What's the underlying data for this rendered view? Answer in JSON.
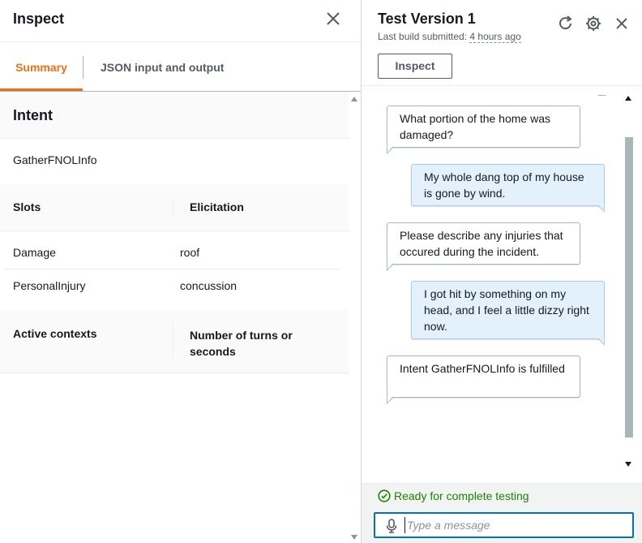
{
  "inspect_panel": {
    "title": "Inspect",
    "tabs": [
      {
        "label": "Summary",
        "active": true
      },
      {
        "label": "JSON input and output",
        "active": false
      }
    ],
    "intent": {
      "heading": "Intent",
      "name": "GatherFNOLInfo"
    },
    "slots_table": {
      "columns": [
        "Slots",
        "Elicitation"
      ],
      "rows": [
        [
          "Damage",
          "roof"
        ],
        [
          "PersonalInjury",
          "concussion"
        ]
      ]
    },
    "contexts_table": {
      "columns": [
        "Active contexts",
        "Number of turns or seconds"
      ]
    }
  },
  "test_panel": {
    "title": "Test Version 1",
    "subtitle_label": "Last build submitted:",
    "subtitle_time": "4 hours ago",
    "inspect_button": "Inspect",
    "messages": [
      {
        "from": "bot",
        "text": "What portion of the home was damaged?"
      },
      {
        "from": "user",
        "text": "My whole dang top of my house is gone by wind."
      },
      {
        "from": "bot",
        "text": "Please describe any injuries that occured during the incident."
      },
      {
        "from": "user",
        "text": "I got hit by something on my head, and I feel a little dizzy right now."
      },
      {
        "from": "bot",
        "text": "Intent GatherFNOLInfo is fulfilled"
      }
    ],
    "status": "Ready for complete testing",
    "input_placeholder": "Type a message"
  },
  "icons": [
    "close-icon",
    "refresh-icon",
    "settings-icon",
    "check-circle-icon",
    "microphone-icon"
  ],
  "colors": {
    "accent_orange": "#ec7211",
    "link_blue": "#0073bb",
    "success_green": "#1d8102",
    "user_bubble": "#e3f1fc"
  }
}
